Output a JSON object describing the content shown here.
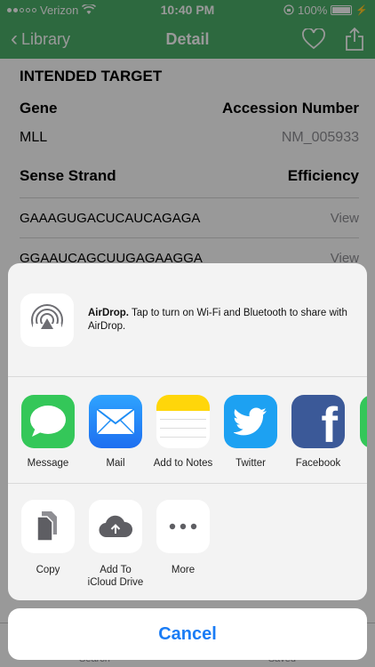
{
  "status_bar": {
    "carrier": "Verizon",
    "time": "10:40 PM",
    "battery": "100%"
  },
  "nav": {
    "back_label": "Library",
    "title": "Detail",
    "icons": [
      "heart-icon",
      "share-icon"
    ]
  },
  "detail": {
    "section_title": "INTENDED TARGET",
    "gene_header": "Gene",
    "accession_header": "Accession Number",
    "gene_value": "MLL",
    "accession_value": "NM_005933",
    "sense_header": "Sense Strand",
    "efficiency_header": "Efficiency",
    "sequences": [
      {
        "seq": "GAAAGUGACUCAUCAGAGA",
        "action": "View"
      },
      {
        "seq": "GGAAUCAGCUUGAGAAGGA",
        "action": "View"
      }
    ]
  },
  "tab_bar": {
    "items": [
      "Search",
      "Saved"
    ]
  },
  "share_sheet": {
    "airdrop_title": "AirDrop.",
    "airdrop_text": " Tap to turn on Wi-Fi and Bluetooth to share with AirDrop.",
    "apps": [
      {
        "label": "Message",
        "icon": "message-icon",
        "color": "#34c759"
      },
      {
        "label": "Mail",
        "icon": "mail-icon",
        "color": "#1e8df5"
      },
      {
        "label": "Add to Notes",
        "icon": "notes-icon",
        "color": "#ffd60a"
      },
      {
        "label": "Twitter",
        "icon": "twitter-icon",
        "color": "#1da1f2"
      },
      {
        "label": "Facebook",
        "icon": "facebook-icon",
        "color": "#3b5998"
      }
    ],
    "actions": [
      {
        "label": "Copy",
        "icon": "copy-icon"
      },
      {
        "label": "Add To\niCloud Drive",
        "icon": "icloud-upload-icon"
      },
      {
        "label": "More",
        "icon": "more-icon"
      }
    ],
    "cancel_label": "Cancel"
  },
  "colors": {
    "nav_green": "#4caf69",
    "accent_blue": "#1a7cf5"
  }
}
